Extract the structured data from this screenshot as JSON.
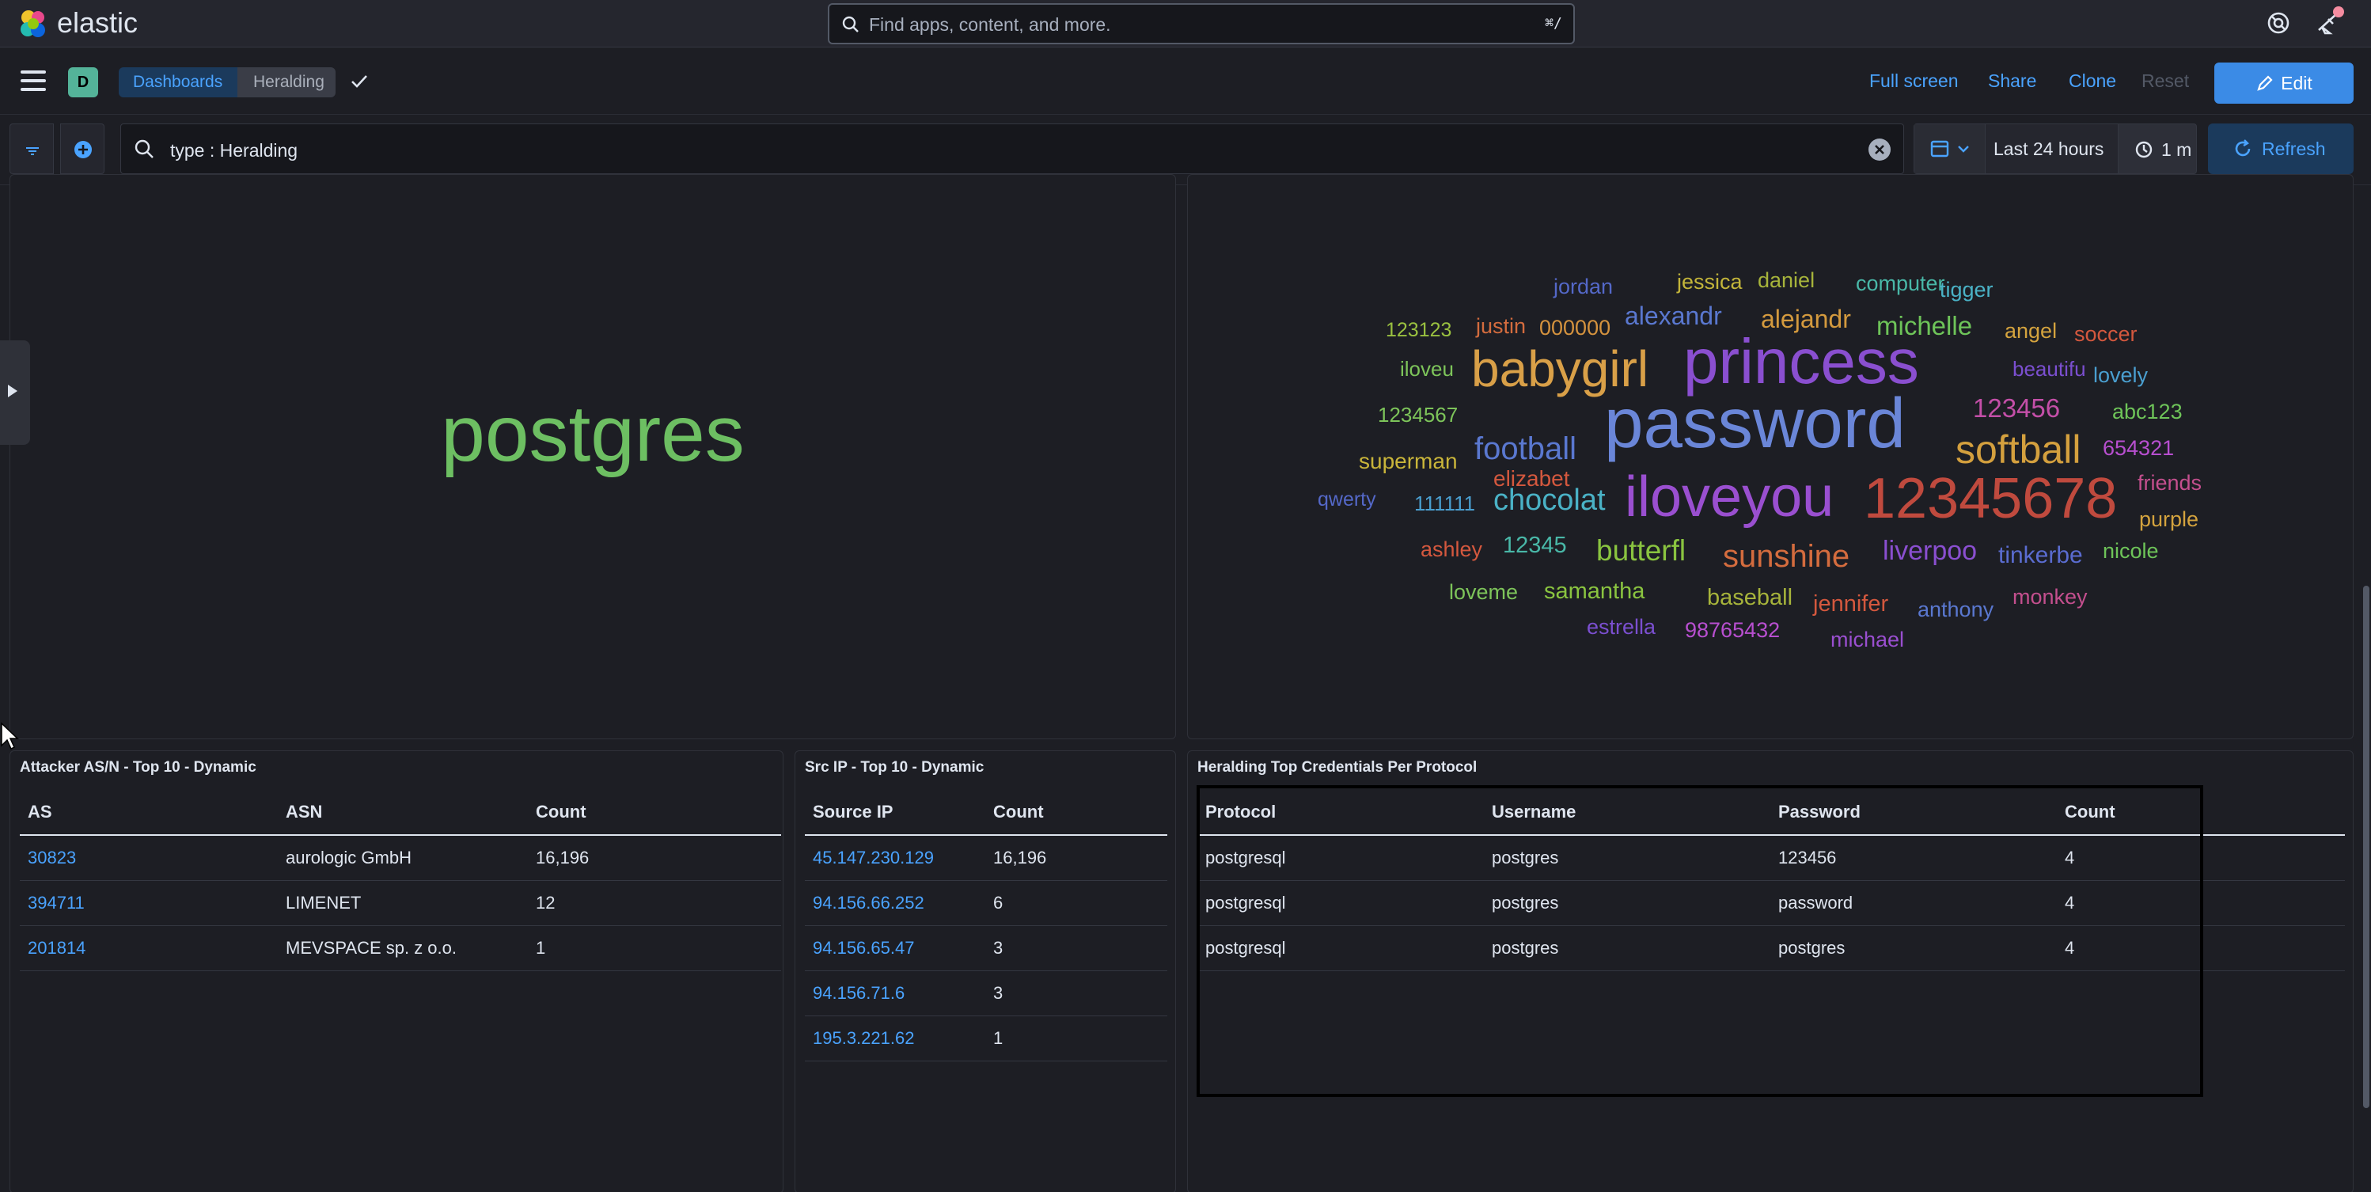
{
  "header": {
    "brand": "elastic",
    "search_placeholder": "Find apps, content, and more.",
    "search_shortcut": "⌘/"
  },
  "nav": {
    "space_initial": "D",
    "breadcrumbs": [
      "Dashboards",
      "Heralding"
    ],
    "links": {
      "full_screen": "Full screen",
      "share": "Share",
      "clone": "Clone",
      "reset": "Reset"
    },
    "edit": "Edit"
  },
  "query": {
    "value": "type : Heralding",
    "date_label": "Last 24 hours",
    "interval": "1 m",
    "refresh": "Refresh"
  },
  "panels": {
    "protocol_cloud": {
      "word": "postgres"
    },
    "password_cloud": {
      "words": [
        {
          "text": "jordan",
          "color": "#5468c8"
        },
        {
          "text": "jessica",
          "color": "#c3b53a"
        },
        {
          "text": "daniel",
          "color": "#a7b43b"
        },
        {
          "text": "computer",
          "color": "#49b8a8"
        },
        {
          "text": "tigger",
          "color": "#4ab2c6"
        },
        {
          "text": "123123",
          "color": "#9ac140"
        },
        {
          "text": "justin",
          "color": "#d46c3e"
        },
        {
          "text": "000000",
          "color": "#d4923e"
        },
        {
          "text": "alexandr",
          "color": "#5a78d0"
        },
        {
          "text": "alejandr",
          "color": "#d49a3e"
        },
        {
          "text": "michelle",
          "color": "#6ec459"
        },
        {
          "text": "angel",
          "color": "#d4a33e"
        },
        {
          "text": "soccer",
          "color": "#d4583e"
        },
        {
          "text": "iloveu",
          "color": "#7dc45a"
        },
        {
          "text": "babygirl",
          "color": "#d9a048"
        },
        {
          "text": "princess",
          "color": "#8a4fd0"
        },
        {
          "text": "beautifu",
          "color": "#7b4fd0"
        },
        {
          "text": "lovely",
          "color": "#4a9fd0"
        },
        {
          "text": "1234567",
          "color": "#7dc45a"
        },
        {
          "text": "password",
          "color": "#6a86d8"
        },
        {
          "text": "123456",
          "color": "#c44fa8"
        },
        {
          "text": "abc123",
          "color": "#6ec459"
        },
        {
          "text": "superman",
          "color": "#c9b53a"
        },
        {
          "text": "football",
          "color": "#5a78d0"
        },
        {
          "text": "softball",
          "color": "#d4a03e"
        },
        {
          "text": "654321",
          "color": "#b84fd0"
        },
        {
          "text": "elizabet",
          "color": "#d4583e"
        },
        {
          "text": "friends",
          "color": "#c44f8e"
        },
        {
          "text": "qwerty",
          "color": "#5468c8"
        },
        {
          "text": "111111",
          "color": "#4a9fd0"
        },
        {
          "text": "chocolat",
          "color": "#4ab2c6"
        },
        {
          "text": "iloveyou",
          "color": "#9a4fd0"
        },
        {
          "text": "12345678",
          "color": "#c04a3e"
        },
        {
          "text": "purple",
          "color": "#d4a33e"
        },
        {
          "text": "ashley",
          "color": "#d4583e"
        },
        {
          "text": "12345",
          "color": "#49b8a8"
        },
        {
          "text": "butterfl",
          "color": "#8ac440"
        },
        {
          "text": "sunshine",
          "color": "#d46c3e"
        },
        {
          "text": "liverpoo",
          "color": "#8a4fd0"
        },
        {
          "text": "tinkerbe",
          "color": "#5a6cd0"
        },
        {
          "text": "nicole",
          "color": "#6ec459"
        },
        {
          "text": "loveme",
          "color": "#7dc45a"
        },
        {
          "text": "samantha",
          "color": "#8ac440"
        },
        {
          "text": "baseball",
          "color": "#a7b43b"
        },
        {
          "text": "jennifer",
          "color": "#d4583e"
        },
        {
          "text": "anthony",
          "color": "#5a78d0"
        },
        {
          "text": "monkey",
          "color": "#c44f8e"
        },
        {
          "text": "estrella",
          "color": "#7b4fd0"
        },
        {
          "text": "98765432",
          "color": "#b84fd0"
        },
        {
          "text": "michael",
          "color": "#9a4fd0"
        }
      ]
    },
    "attacker_asn": {
      "title": "Attacker AS/N - Top 10 - Dynamic",
      "columns": [
        "AS",
        "ASN",
        "Count"
      ],
      "rows": [
        [
          "30823",
          "aurologic GmbH",
          "16,196"
        ],
        [
          "394711",
          "LIMENET",
          "12"
        ],
        [
          "201814",
          "MEVSPACE sp. z o.o.",
          "1"
        ]
      ]
    },
    "src_ip": {
      "title": "Src IP - Top 10 - Dynamic",
      "columns": [
        "Source IP",
        "Count"
      ],
      "rows": [
        [
          "45.147.230.129",
          "16,196"
        ],
        [
          "94.156.66.252",
          "6"
        ],
        [
          "94.156.65.47",
          "3"
        ],
        [
          "94.156.71.6",
          "3"
        ],
        [
          "195.3.221.62",
          "1"
        ]
      ]
    },
    "creds": {
      "title": "Heralding Top Credentials Per Protocol",
      "columns": [
        "Protocol",
        "Username",
        "Password",
        "Count"
      ],
      "rows": [
        [
          "postgresql",
          "postgres",
          "123456",
          "4"
        ],
        [
          "postgresql",
          "postgres",
          "password",
          "4"
        ],
        [
          "postgresql",
          "postgres",
          "postgres",
          "4"
        ]
      ]
    }
  },
  "colors": {
    "accent": "#4aa3ff",
    "primary_button": "#3b8be6",
    "protocol_word": "#6dbf62"
  }
}
